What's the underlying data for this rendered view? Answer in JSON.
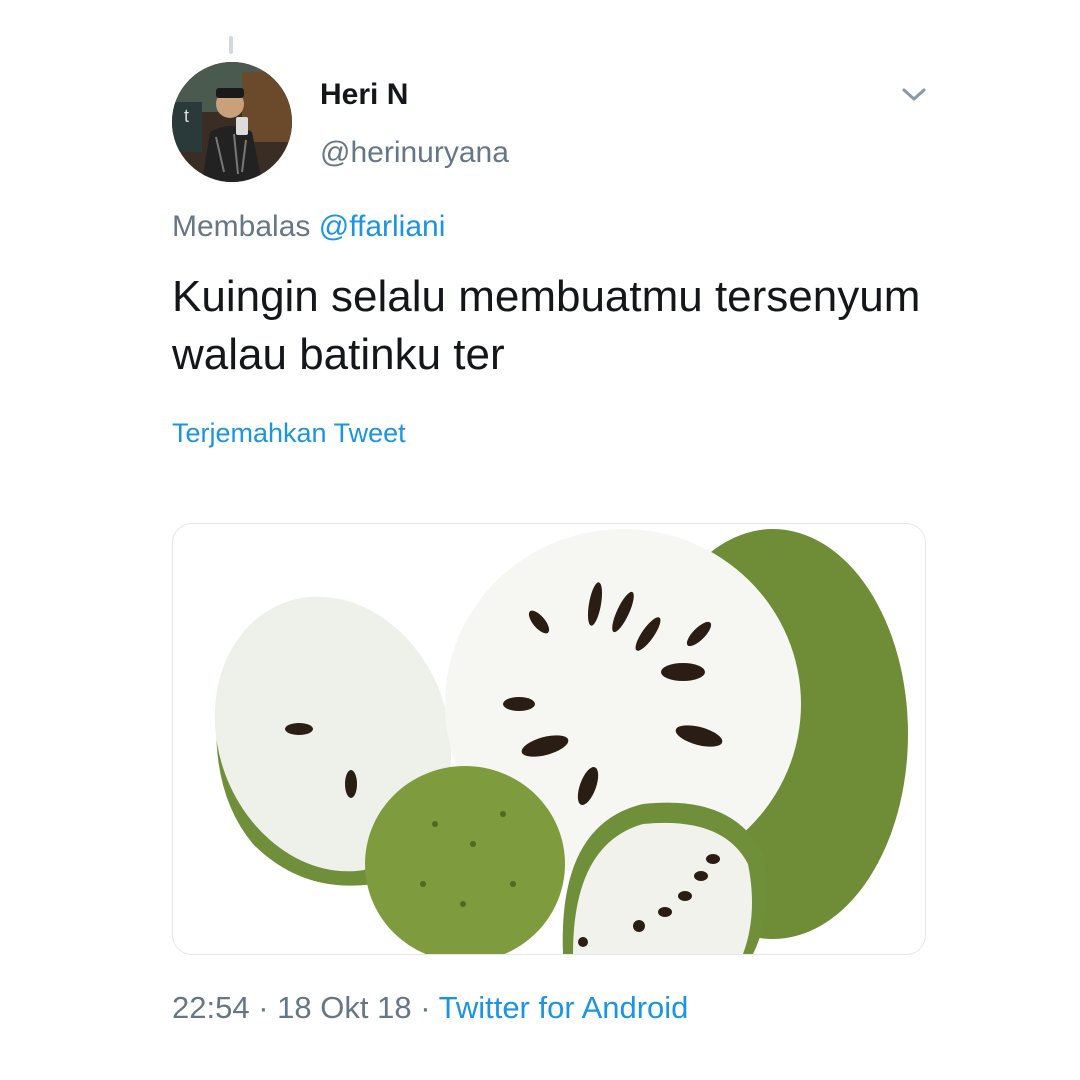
{
  "user": {
    "display_name": "Heri N",
    "handle": "@herinuryana"
  },
  "reply": {
    "prefix": "Membalas",
    "mention": "@ffarliani"
  },
  "tweet": {
    "text": "Kuingin selalu membuatmu tersenyum walau batinku ter"
  },
  "translate_label": "Terjemahkan Tweet",
  "meta": {
    "time": "22:54",
    "separator": "·",
    "date": "18 Okt 18",
    "source": "Twitter for Android"
  },
  "icons": {
    "menu": "chevron-down-icon"
  },
  "colors": {
    "link": "#1b95e0",
    "secondary_text": "#657786",
    "primary_text": "#14171a"
  }
}
